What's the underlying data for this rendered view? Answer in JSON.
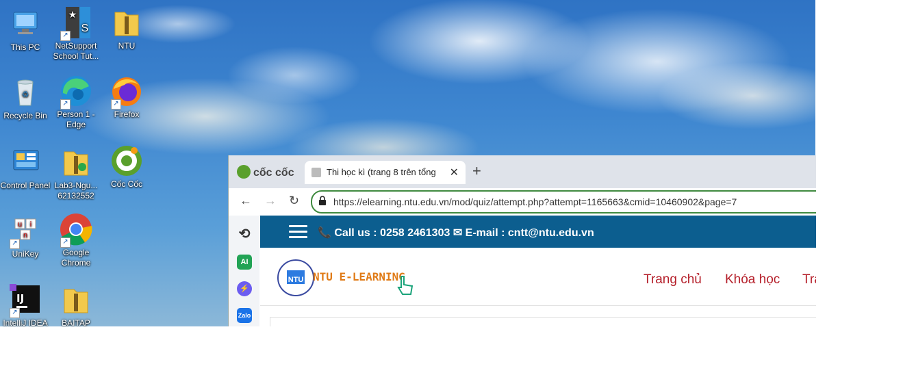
{
  "desktop": {
    "icons": [
      {
        "label": "This PC"
      },
      {
        "label": "NetSupport School Tut..."
      },
      {
        "label": "NTU"
      },
      {
        "label": "Recycle Bin"
      },
      {
        "label": "Person 1 - Edge"
      },
      {
        "label": "Firefox"
      },
      {
        "label": "Control Panel"
      },
      {
        "label": "Lab3-Ngu... 62132552"
      },
      {
        "label": "Cốc Cốc"
      },
      {
        "label": "UniKey"
      },
      {
        "label": "Google Chrome"
      },
      {
        "label": "IntelliJ IDEA"
      },
      {
        "label": "BAITAP"
      }
    ]
  },
  "browser": {
    "brand": "cốc cốc",
    "tab": {
      "title": "Thi học kì (trang 8 trên tổng",
      "close": "✕"
    },
    "new_tab": "+",
    "nav": {
      "back": "←",
      "forward": "→",
      "reload": "↻"
    },
    "address": "https://elearning.ntu.edu.vn/mod/quiz/attempt.php?attempt=1165663&cmid=10460902&page=7",
    "sidebar": {
      "ai": "AI",
      "zalo": "Zalo"
    }
  },
  "site": {
    "contact": "📞 Call us : 0258 2461303 ✉ E-mail : cntt@ntu.edu.vn",
    "logo_text": "NTU E-LEARNING",
    "logo_mark": "NTU",
    "menu": [
      "Trang chủ",
      "Khóa học",
      "Tra"
    ]
  },
  "colors": {
    "top_bar": "#0c5e8f",
    "menu_text": "#b51f2a",
    "logo_text": "#e07b17",
    "address_border": "#3f8a3f"
  }
}
